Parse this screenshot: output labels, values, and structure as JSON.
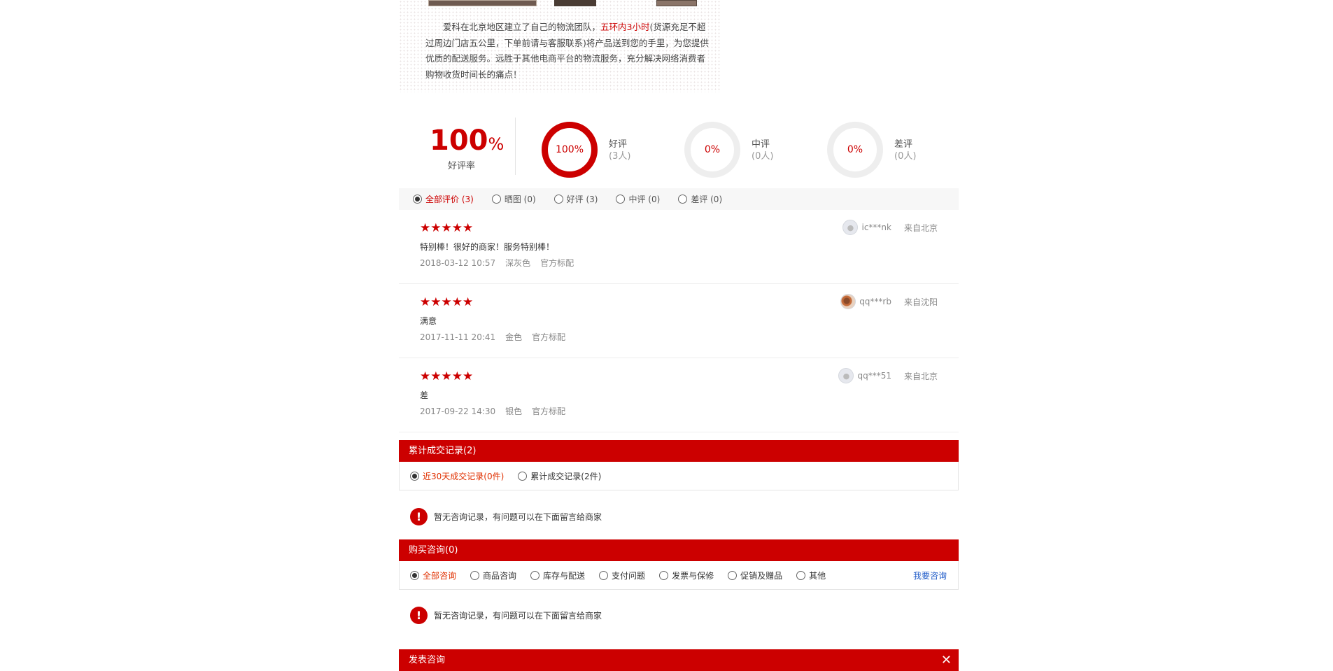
{
  "intro": {
    "text_before": "爱科在北京地区建立了自己的物流团队，",
    "highlight": "五环内3小时",
    "text_after": "(货源充足不超过周边门店五公里，下单前请与客服联系)将产品送到您的手里，为您提供优质的配送服务。远胜于其他电商平台的物流服务，充分解决网络消费者购物收货时间长的痛点！"
  },
  "summary": {
    "good_rate": "100",
    "good_rate_unit": "%",
    "good_rate_label": "好评率",
    "rings": [
      {
        "percent": "100%",
        "label": "好评",
        "count": "(3人)",
        "fill": 1.0
      },
      {
        "percent": "0%",
        "label": "中评",
        "count": "(0人)",
        "fill": 0
      },
      {
        "percent": "0%",
        "label": "差评",
        "count": "(0人)",
        "fill": 0
      }
    ]
  },
  "filters": [
    {
      "label": "全部评价 (3)",
      "selected": true
    },
    {
      "label": "晒图 (0)",
      "selected": false
    },
    {
      "label": "好评 (3)",
      "selected": false
    },
    {
      "label": "中评 (0)",
      "selected": false
    },
    {
      "label": "差评 (0)",
      "selected": false
    }
  ],
  "reviews": [
    {
      "stars": "★★★★★",
      "rating": 5,
      "text": "特别棒！很好的商家！服务特别棒！",
      "date": "2018-03-12 10:57",
      "color": "深灰色",
      "package": "官方标配",
      "user": "ic***nk",
      "from": "来自北京"
    },
    {
      "stars": "★★★★★",
      "rating": 5,
      "text": "满意",
      "date": "2017-11-11 20:41",
      "color": "金色",
      "package": "官方标配",
      "user": "qq***rb",
      "from": "来自沈阳"
    },
    {
      "stars": "★★★★★",
      "rating": 5,
      "text": "差",
      "date": "2017-09-22 14:30",
      "color": "银色",
      "package": "官方标配",
      "user": "qq***51",
      "from": "来自北京"
    }
  ],
  "transactions": {
    "title": "累计成交记录(2)",
    "tabs": [
      {
        "label": "近30天成交记录(0件)",
        "selected": true
      },
      {
        "label": "累计成交记录(2件)",
        "selected": false
      }
    ]
  },
  "notice_text": "暂无咨询记录，有问题可以在下面留言给商家",
  "consult": {
    "title": "购买咨询(0)",
    "tabs": [
      {
        "label": "全部咨询",
        "selected": true
      },
      {
        "label": "商品咨询",
        "selected": false
      },
      {
        "label": "库存与配送",
        "selected": false
      },
      {
        "label": "支付问题",
        "selected": false
      },
      {
        "label": "发票与保修",
        "selected": false
      },
      {
        "label": "促销及赠品",
        "selected": false
      },
      {
        "label": "其他",
        "selected": false
      }
    ],
    "ask_label": "我要咨询"
  },
  "publish": {
    "title": "发表咨询",
    "close_glyph": "✕"
  },
  "colors": {
    "brand_red": "#cc0000",
    "link_blue": "#1e5ac8",
    "active_orange": "#e03000"
  },
  "icons": {
    "warning": "exclamation-circle-icon",
    "close": "close-icon",
    "star": "star-icon",
    "radio": "radio-icon",
    "avatar": "user-avatar-icon"
  }
}
